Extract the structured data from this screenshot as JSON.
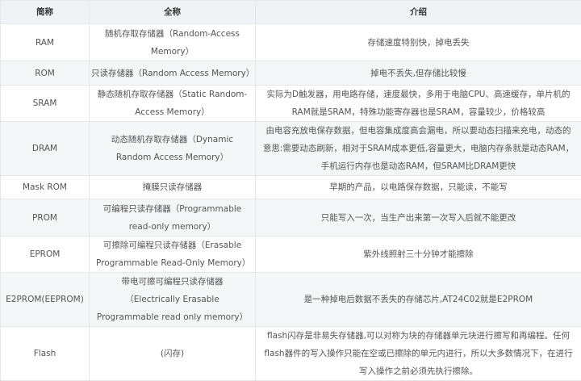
{
  "headers": [
    "简称",
    "全称",
    "介绍"
  ],
  "rows": [
    {
      "abbr": "RAM",
      "full": "随机存取存储器（Random-Access Memory）",
      "desc": "存储速度特别快，掉电丢失"
    },
    {
      "abbr": "ROM",
      "full": "只读存储器（Random Access Memory）",
      "desc": "掉电不丢失,但存储比较慢"
    },
    {
      "abbr": "SRAM",
      "full": "静态随机存取存储器（Static Random-Access Memory）",
      "desc": "实际为D触发器，用电路存储，速度最快，多用于电脑CPU、高速缓存，单片机的RAM就是SRAM，特殊功能寄存器也是SRAM，容量较少，价格较高"
    },
    {
      "abbr": "DRAM",
      "full": "动态随机存取存储器（Dynamic Random Access Memory）",
      "desc": "由电容充放电保存数据，但电容集成度高会漏电，所以要动态扫描来充电，动态的意思:需要动态刷新，相对于SRAM成本更低,容量更大，电脑内存条就是动态RAM，手机运行内存也是动态RAM，但SRAM比DRAM更快"
    },
    {
      "abbr": "Mask ROM",
      "full": "掩膜只读存储器",
      "desc": "早期的产品，以电路保存数据，只能读，不能写"
    },
    {
      "abbr": "PROM",
      "full": "可编程只读存储器（Programmable read-only memory）",
      "desc": "只能写入一次，当生产出来第一次写入后就不能更改"
    },
    {
      "abbr": "EPROM",
      "full": "可擦除可编程只读存储器（Erasable Programmable Read-Only Memory）",
      "desc": "紫外线照射三十分钟才能擦除"
    },
    {
      "abbr": "E2PROM(EEPROM)",
      "full": "带电可擦可编程只读存储器（Electrically Erasable Programmable read only memory）",
      "desc": "是一种掉电后数据不丢失的存储芯片,AT24C02就是E2PROM"
    },
    {
      "abbr": "Flash",
      "full": "(闪存)",
      "desc": "flash闪存是非易失存储器,可以对称为块的存储器单元块进行擦写和再编程。任何flash器件的写入操作只能在空或已擦除的单元内进行，所以大多数情况下，在进行写入操作之前必须先执行擦除。"
    }
  ]
}
